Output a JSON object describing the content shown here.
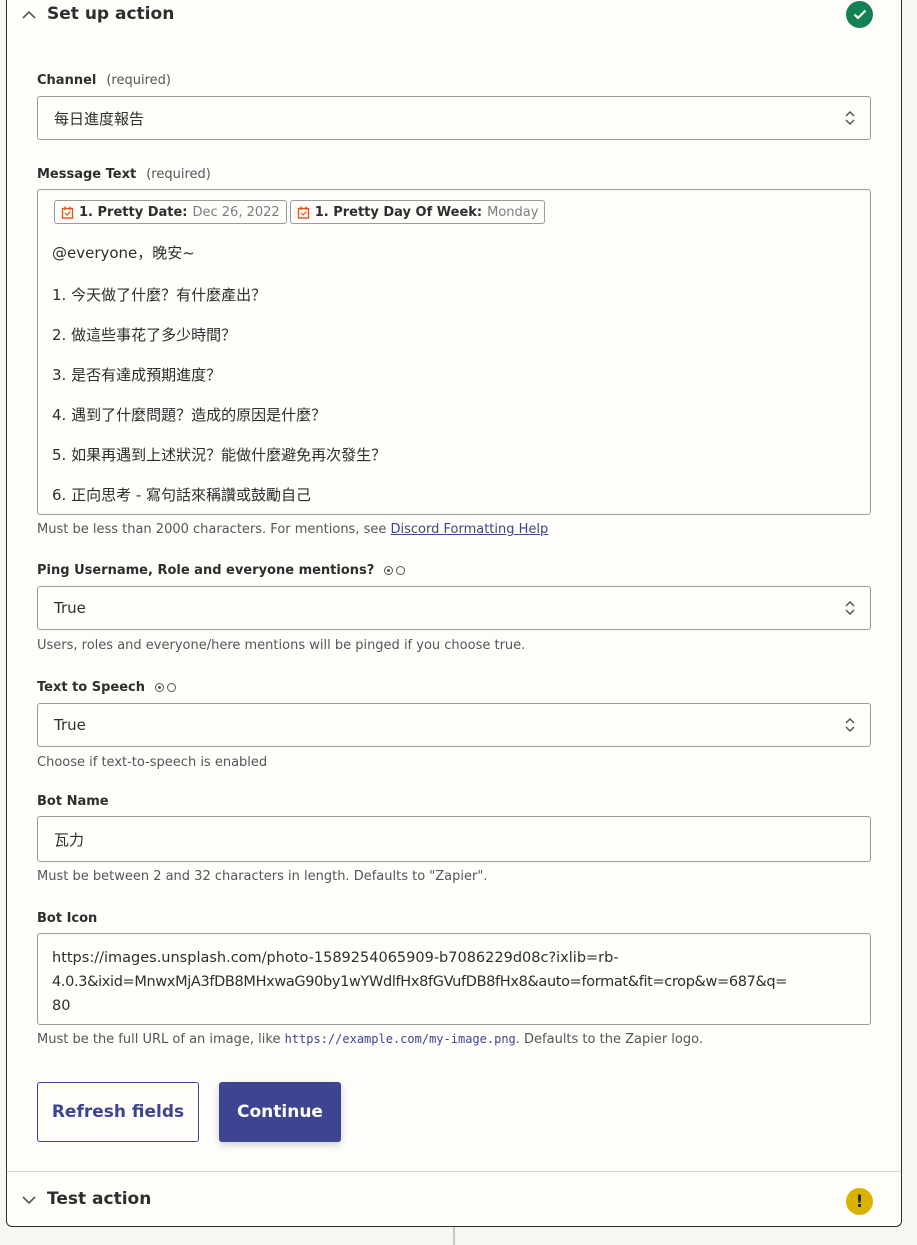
{
  "setup": {
    "title": "Set up action",
    "status": "complete"
  },
  "channel": {
    "label": "Channel",
    "required": "(required)",
    "value": "每日進度報告"
  },
  "message": {
    "label": "Message Text",
    "required": "(required)",
    "pills": [
      {
        "label": "1. Pretty Date:",
        "value": "Dec 26, 2022"
      },
      {
        "label": "1. Pretty Day Of Week:",
        "value": "Monday"
      }
    ],
    "lines": [
      "@everyone，晚安~",
      "1. 今天做了什麼？有什麼產出？",
      "2. 做這些事花了多少時間？",
      "3. 是否有達成預期進度？",
      "4. 遇到了什麼問題？造成的原因是什麼？",
      "5. 如果再遇到上述狀況？能做什麼避免再次發生？",
      "6. 正向思考 - 寫句話來稱讚或鼓勵自己"
    ],
    "help_text": "Must be less than 2000 characters. For mentions, see ",
    "help_link": "Discord Formatting Help"
  },
  "ping": {
    "label": "Ping Username, Role and everyone mentions?",
    "value": "True",
    "help": "Users, roles and everyone/here mentions will be pinged if you choose true."
  },
  "tts": {
    "label": "Text to Speech",
    "value": "True",
    "help": "Choose if text-to-speech is enabled"
  },
  "bot_name": {
    "label": "Bot Name",
    "value": "瓦力",
    "help": "Must be between 2 and 32 characters in length. Defaults to \"Zapier\"."
  },
  "bot_icon": {
    "label": "Bot Icon",
    "value_lines": [
      "https://images.unsplash.com/photo-1589254065909-b7086229d08c?ixlib=rb-",
      "4.0.3&ixid=MnwxMjA3fDB8MHxwaG90by1wYWdlfHx8fGVufDB8fHx8&auto=format&fit=crop&w=687&q=",
      "80"
    ],
    "help_prefix": "Must be the full URL of an image, like ",
    "help_code": "https://example.com/my-image.png",
    "help_suffix": ". Defaults to the Zapier logo."
  },
  "buttons": {
    "refresh": "Refresh fields",
    "continue": "Continue"
  },
  "test": {
    "title": "Test action",
    "status_glyph": "!"
  },
  "colors": {
    "accent": "#3d4592",
    "success": "#148155",
    "warning": "#d7b300",
    "pill_icon": "#e3541e"
  }
}
